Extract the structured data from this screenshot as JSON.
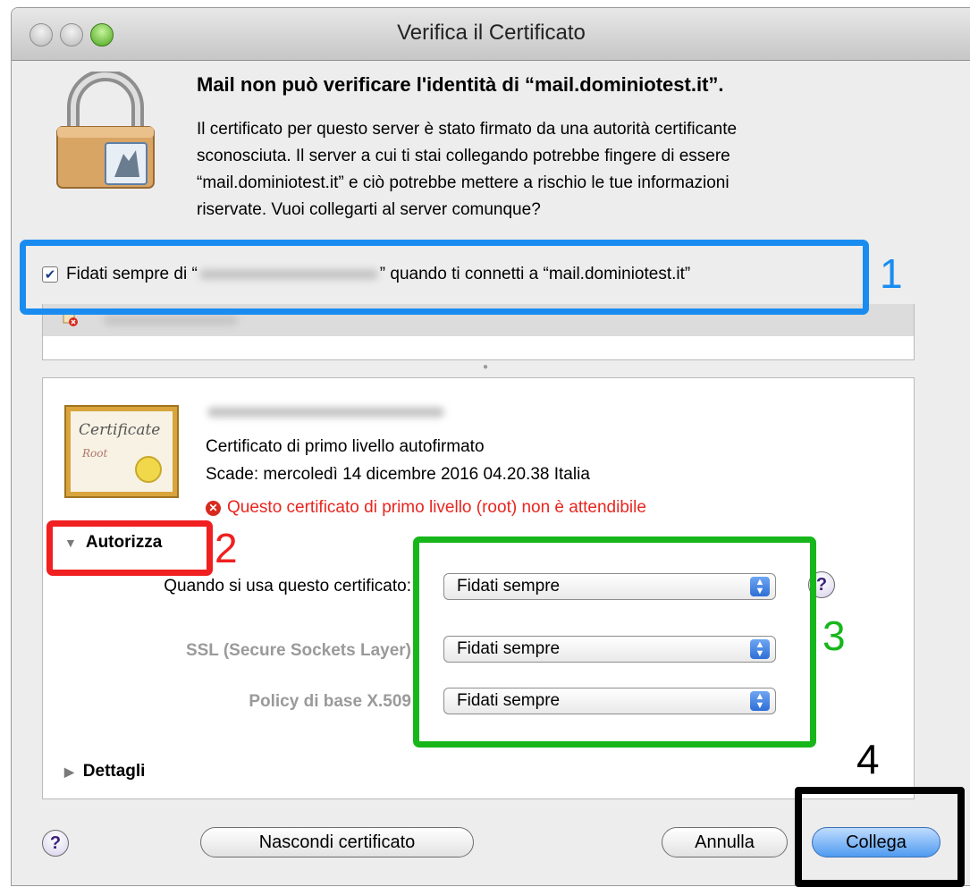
{
  "window": {
    "title": "Verifica il Certificato"
  },
  "message": {
    "headline": "Mail non può verificare l'identità di “mail.dominiotest.it”.",
    "body_lines": [
      "Il certificato per questo server è stato firmato da una autorità certificante",
      "sconosciuta. Il server a cui ti stai collegando potrebbe fingere di essere",
      "“mail.dominiotest.it” e ciò potrebbe mettere a rischio le tue informazioni",
      "riservate. Vuoi collegarti al server comunque?"
    ]
  },
  "always_trust": {
    "checked": true,
    "prefix": "Fidati sempre di “",
    "suffix": "” quando ti connetti a “mail.dominiotest.it”"
  },
  "certificate": {
    "type": "Certificato di primo livello autofirmato",
    "expires": "Scade: mercoledì 14 dicembre 2016 04.20.38 Italia",
    "warning": "Questo certificato di primo livello (root) non è attendibile",
    "icon_text_1": "Certificate",
    "icon_text_2": "Root"
  },
  "trust_section": {
    "label": "Autorizza",
    "expanded": true,
    "rows": [
      {
        "label": "Quando si usa questo certificato:",
        "value": "Fidati sempre"
      },
      {
        "label": "SSL (Secure Sockets Layer)",
        "value": "Fidati sempre"
      },
      {
        "label": "Policy di base X.509",
        "value": "Fidati sempre"
      }
    ]
  },
  "details_section": {
    "label": "Dettagli",
    "expanded": false
  },
  "buttons": {
    "help": "?",
    "hide_certificate": "Nascondi certificato",
    "cancel": "Annulla",
    "connect": "Collega"
  },
  "annotations": [
    "1",
    "2",
    "3",
    "4"
  ],
  "colors": {
    "annotation_1": "#1a8cf0",
    "annotation_2": "#f02020",
    "annotation_3": "#17b61b",
    "annotation_4": "#000000",
    "warning": "#e8261f"
  }
}
